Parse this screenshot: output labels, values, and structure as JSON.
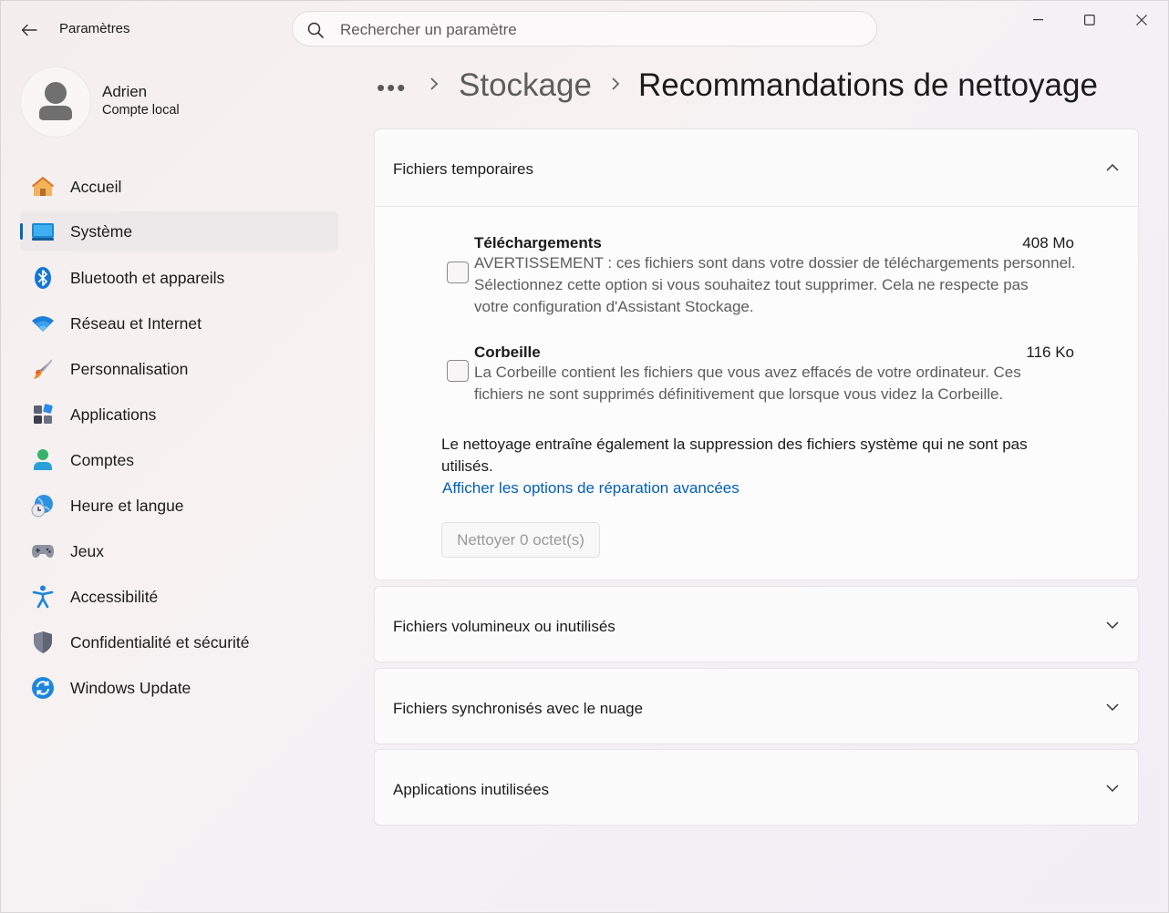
{
  "window": {
    "app_title": "Paramètres",
    "search_placeholder": "Rechercher un paramètre"
  },
  "account": {
    "name": "Adrien",
    "type": "Compte local"
  },
  "nav": {
    "items": [
      {
        "label": "Accueil",
        "icon": "home-icon"
      },
      {
        "label": "Système",
        "icon": "system-icon",
        "active": true
      },
      {
        "label": "Bluetooth et appareils",
        "icon": "bluetooth-icon"
      },
      {
        "label": "Réseau et Internet",
        "icon": "wifi-icon"
      },
      {
        "label": "Personnalisation",
        "icon": "brush-icon"
      },
      {
        "label": "Applications",
        "icon": "apps-icon"
      },
      {
        "label": "Comptes",
        "icon": "accounts-icon"
      },
      {
        "label": "Heure et langue",
        "icon": "time-language-icon"
      },
      {
        "label": "Jeux",
        "icon": "gamepad-icon"
      },
      {
        "label": "Accessibilité",
        "icon": "accessibility-icon"
      },
      {
        "label": "Confidentialité et sécurité",
        "icon": "shield-icon"
      },
      {
        "label": "Windows Update",
        "icon": "update-icon"
      }
    ]
  },
  "breadcrumb": {
    "more": "•••",
    "parent": "Stockage",
    "current": "Recommandations de nettoyage"
  },
  "sections": {
    "temp": {
      "title": "Fichiers temporaires",
      "expanded": true,
      "downloads": {
        "title": "Téléchargements",
        "size": "408 Mo",
        "desc_lines": [
          "AVERTISSEMENT : ces fichiers sont dans votre dossier de téléchargements personnel.",
          "Sélectionnez cette option si vous souhaitez tout supprimer. Cela ne respecte pas",
          "votre configuration d'Assistant Stockage."
        ]
      },
      "recycle": {
        "title": "Corbeille",
        "size": "116 Ko",
        "desc_lines": [
          "La Corbeille contient les fichiers que vous avez effacés de votre ordinateur. Ces",
          "fichiers ne sont supprimés définitivement que lorsque vous videz la Corbeille."
        ]
      },
      "note_lines": [
        "Le nettoyage entraîne également la suppression des fichiers système qui ne sont pas",
        "utilisés."
      ],
      "link": "Afficher les options de réparation avancées",
      "button": "Nettoyer 0 octet(s)"
    },
    "large": {
      "title": "Fichiers volumineux ou inutilisés"
    },
    "cloud": {
      "title": "Fichiers synchronisés avec le nuage"
    },
    "apps": {
      "title": "Applications inutilisées"
    }
  },
  "colors": {
    "accent": "#0067c0",
    "link": "#005fb8"
  }
}
